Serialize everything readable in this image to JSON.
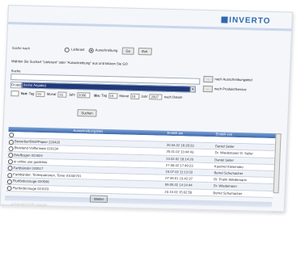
{
  "brand": {
    "logo_text": "INVERTO"
  },
  "search_mode": {
    "label": "Suche nach",
    "options": [
      "Lieferant",
      "Ausschreibung"
    ],
    "selected": "Ausschreibung",
    "go_label": "Go",
    "exit_label": "Exit"
  },
  "instructions": "Wählen Sie Suchart \"Lieferant\" oder \"Ausschreibung\" aus und klicken Sie GO",
  "search_field": {
    "label": "Suche",
    "value": ""
  },
  "tender_title_button": {
    "arrow": "...",
    "label": "nach Ausschreibungstitel"
  },
  "product_service": {
    "prefix": "Gruppe",
    "selected": "(keine Angabe)",
    "arrow": "...",
    "label": "nach Produkt/Service"
  },
  "date_filter": {
    "from_label": "Von:",
    "to_label": "Bis:",
    "day_label": "Tag",
    "month_label": "Monat",
    "year_label": "Jahr",
    "from_day": "01",
    "from_month": "01",
    "from_year": "2006",
    "to_day": "01",
    "to_month": "01",
    "to_year": "2007",
    "suffix": "nach Datum"
  },
  "search_button": "Suchen",
  "table": {
    "headers": [
      "Ausschreibungstitel",
      "Erstellt am",
      "Erstellt von"
    ],
    "rows": [
      [
        "",
        "",
        ""
      ],
      [
        "Bewerber/Brief/Papier 220420",
        "20.04.02 16:28:23",
        "Daniel Seiler"
      ],
      [
        "Bleistand Vollformate 020134",
        "25.01.02 13:44:43",
        "Dr. Wiedemann/ D. Seiler"
      ],
      [
        "Briefbogen 022624",
        "13.02.02 18:14:20",
        "Daniel Seiler"
      ],
      [
        "ei online use guideline",
        "27.06.02 17:49:23",
        "Kaschel Kleinmidro"
      ],
      [
        "Farbbänder 020517",
        "15.07.02 11:12:03",
        "Bernd Schumacher"
      ],
      [
        "Farbbänder, Tintenpatronen, Toner 01030701",
        "07.09.01 13:42:37",
        "Dr. Frank Wiedemann"
      ],
      [
        "Flurförderzeuge 020506",
        "09.05.02 14:14:44",
        "Dr. Wiedemann"
      ],
      [
        "Flurförderzeuge 021023",
        "23.10.02 15:02:58",
        "Bernd Schumacher"
      ]
    ]
  },
  "next_button": "Weiter",
  "reflection_text": "Flurförderzeuge 020506"
}
